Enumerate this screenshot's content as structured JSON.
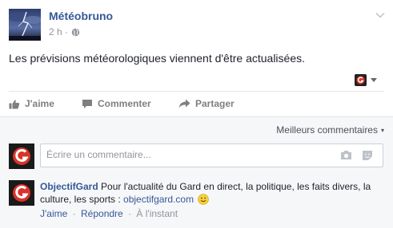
{
  "post": {
    "author": "Météobruno",
    "time": "2 h",
    "separator": "·",
    "text": "Les prévisions météorologiques viennent d'être actualisées.",
    "icons": {
      "privacy": "globe-icon",
      "menu": "chevron-down-icon",
      "audience_caret": "caret-down-icon"
    }
  },
  "actions": [
    {
      "label": "J'aime",
      "icon": "thumbs-up-icon"
    },
    {
      "label": "Commenter",
      "icon": "comment-icon"
    },
    {
      "label": "Partager",
      "icon": "share-arrow-icon"
    }
  ],
  "comments": {
    "sort_label": "Meilleurs commentaires",
    "sort_caret": "▾",
    "input_placeholder": "Écrire un commentaire...",
    "input_icons": [
      "camera-icon",
      "sticker-icon"
    ],
    "items": [
      {
        "author": "ObjectifGard",
        "text": "Pour l'actualité du Gard en direct, la politique, les faits divers, la culture, les sports : ",
        "link": "objectifgard.com",
        "emoji": "smiley-icon",
        "actions": {
          "like": "J'aime",
          "reply": "Répondre",
          "time": "À l'instant",
          "dot": "·"
        }
      }
    ]
  },
  "colors": {
    "link_blue": "#365899",
    "meta_gray": "#90949c",
    "action_gray": "#7f7f7f",
    "comments_bg": "#f6f7f9",
    "logo_red": "#d9342a"
  }
}
